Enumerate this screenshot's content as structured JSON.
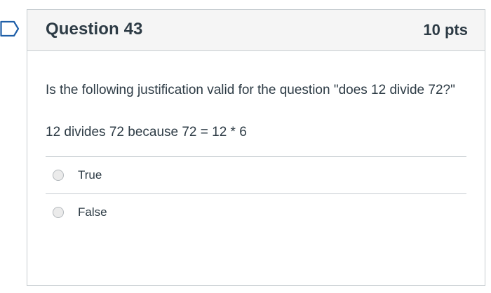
{
  "question": {
    "title": "Question 43",
    "points": "10 pts",
    "text": "Is the following justification valid for the question \"does 12 divide 72?\"",
    "statement": "12 divides 72 because 72 = 12 * 6",
    "answers": [
      {
        "label": "True",
        "selected": false
      },
      {
        "label": "False",
        "selected": false
      }
    ]
  },
  "icons": {
    "flag": "bookmark-flag-icon"
  },
  "colors": {
    "flag_outline": "#1f5fa8",
    "header_bg": "#f5f5f5",
    "border": "#c7cdd1",
    "text": "#2d3b45"
  }
}
